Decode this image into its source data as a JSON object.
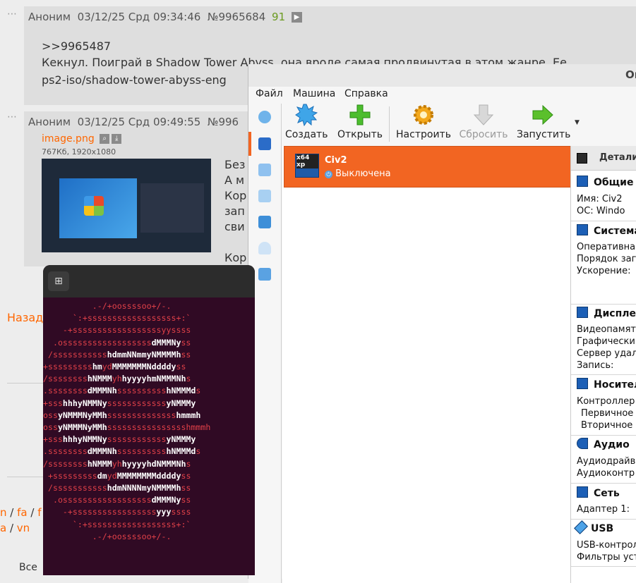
{
  "forum": {
    "post1": {
      "author": "Аноним",
      "datetime": "03/12/25 Срд 09:34:46",
      "number": "№9965684",
      "replies": "91",
      "reply_link": ">>9965487",
      "text": "Кекнул. Поиграй в Shadow Tower Abyss, она вроде самая продвинутая в этом жанре. Ее",
      "link": "ps2-iso/shadow-tower-abyss-eng"
    },
    "post2": {
      "author": "Аноним",
      "datetime": "03/12/25 Срд 09:49:55",
      "number": "№996",
      "file_name": "image.png",
      "file_info": "767Кб, 1920x1080",
      "text_lines": [
        "Без",
        "А м",
        "Кор",
        "зап",
        "сви",
        "",
        "Кор"
      ]
    },
    "back_link": "Назад",
    "board_links": [
      "n",
      "fa",
      "f",
      "a",
      "vn"
    ],
    "bottom_text": "Все"
  },
  "vbox": {
    "title": "Or",
    "menu": [
      "Файл",
      "Машина",
      "Справка"
    ],
    "toolbar": [
      {
        "label": "Создать",
        "icon": "new-vm-icon"
      },
      {
        "label": "Открыть",
        "icon": "add-vm-icon"
      },
      {
        "label": "Настроить",
        "icon": "settings-gear-icon"
      },
      {
        "label": "Сбросить",
        "icon": "discard-arrow-icon"
      },
      {
        "label": "Запустить",
        "icon": "start-arrow-icon"
      }
    ],
    "vm": {
      "name": "Civ2",
      "state": "Выключена",
      "os_badge": "x64 xp"
    },
    "details_tab": "Детали",
    "sections": {
      "general": {
        "title": "Общие",
        "rows": [
          "Имя:   Civ2",
          "ОС:    Windo"
        ]
      },
      "system": {
        "title": "Система",
        "rows": [
          "Оперативна",
          "Порядок заг",
          "Ускорение:"
        ]
      },
      "display": {
        "title": "Дисплей",
        "rows": [
          "Видеопамят",
          "Графически",
          "Сервер удал",
          "Запись:"
        ]
      },
      "storage": {
        "title": "Носител",
        "rows": [
          "Контроллер",
          " Первичное",
          " Вторичное"
        ]
      },
      "audio": {
        "title": "Аудио",
        "rows": [
          "Аудиодрайв",
          "Аудиоконтр"
        ]
      },
      "network": {
        "title": "Сеть",
        "rows": [
          "Адаптер 1:"
        ]
      },
      "usb": {
        "title": "USB",
        "rows": [
          "USB-контрол",
          "Фильтры уст"
        ]
      }
    }
  },
  "terminal": {
    "newtab_icon": "new-tab-icon"
  },
  "colors": {
    "accent_orange": "#ff6600",
    "vm_selected": "#f26522",
    "terminal_bg": "#300a24"
  }
}
